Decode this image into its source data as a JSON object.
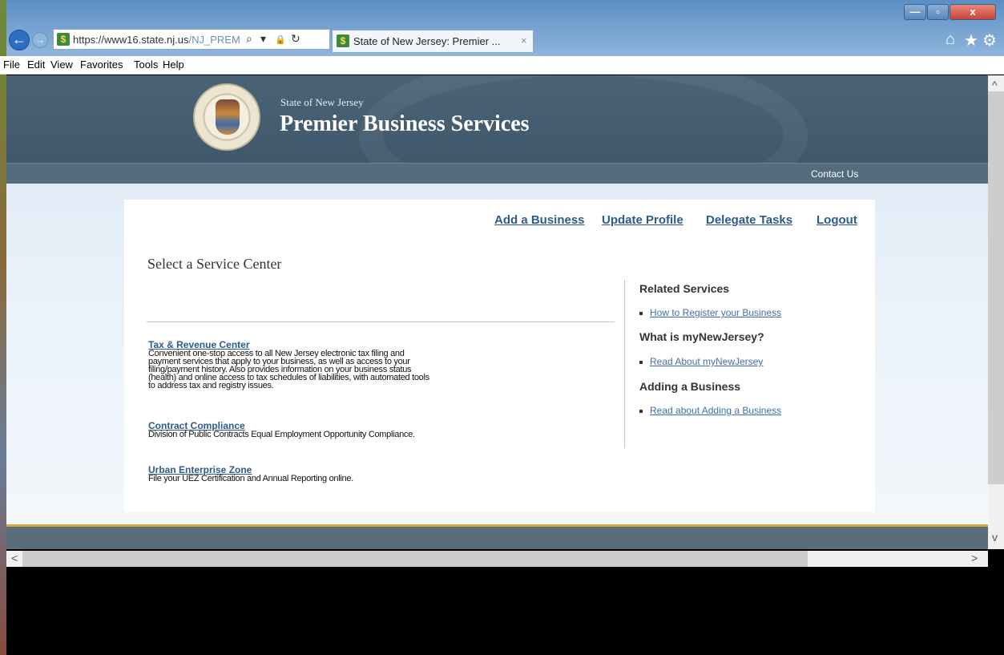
{
  "browser": {
    "url_host": "https://www16.state.nj.us",
    "url_path": "/NJ_PREMI",
    "tab_title": "State of New Jersey: Premier ...",
    "tab_close": "×",
    "menu": [
      "File",
      "Edit",
      "View",
      "Favorites",
      "Tools",
      "Help"
    ],
    "window_buttons": {
      "minimize": "—",
      "maximize": "▫",
      "close": "x"
    },
    "icons": {
      "back": "←",
      "forward": "→",
      "search": "⌕",
      "dropdown": "▾",
      "lock": "🔒",
      "refresh": "↻",
      "home": "⌂",
      "favorites": "★",
      "settings": "⚙"
    }
  },
  "header": {
    "state_label": "State of New Jersey",
    "brand": "Premier Business Services",
    "contact_us": "Contact Us"
  },
  "top_links": [
    "Add a Business",
    "Update Profile",
    "Delegate Tasks",
    "Logout"
  ],
  "main": {
    "heading": "Select a Service Center",
    "services": [
      {
        "title": "Tax & Revenue Center",
        "desc": "Convenient one-stop access to all New Jersey electronic tax filing and payment services that apply to your business, as well as access to your filing/payment history. Also provides information on your business status (health) and online access to tax schedules of liabilities, with automated tools to address tax and registry issues."
      },
      {
        "title": "Contract Compliance",
        "desc": "Division of Public Contracts Equal Employment Opportunity Compliance."
      },
      {
        "title": "Urban Enterprise Zone",
        "desc": "File your UEZ Certification and Annual Reporting online."
      }
    ]
  },
  "sidebar": {
    "sections": [
      {
        "heading": "Related Services",
        "link": "How to Register your Business"
      },
      {
        "heading": "What is myNewJersey?",
        "link": "Read About myNewJersey"
      },
      {
        "heading": "Adding a Business",
        "link": "Read about Adding a Business"
      }
    ]
  },
  "scroll": {
    "up": "^",
    "down": "v",
    "left": "<",
    "right": ">"
  }
}
